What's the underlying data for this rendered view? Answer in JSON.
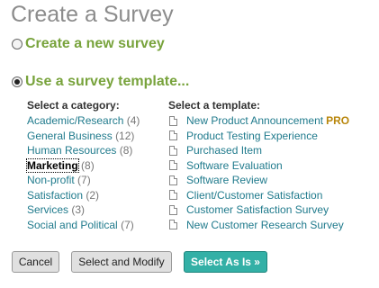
{
  "page": {
    "title": "Create a Survey"
  },
  "options": {
    "new_label": "Create a new survey",
    "template_label": "Use a survey template..."
  },
  "categories": {
    "header": "Select a category:",
    "items": [
      {
        "name": "Academic/Research",
        "count": "(4)"
      },
      {
        "name": "General Business",
        "count": "(12)"
      },
      {
        "name": "Human Resources",
        "count": "(8)"
      },
      {
        "name": "Marketing",
        "count": "(8)"
      },
      {
        "name": "Non-profit",
        "count": "(7)"
      },
      {
        "name": "Satisfaction",
        "count": "(2)"
      },
      {
        "name": "Services",
        "count": "(3)"
      },
      {
        "name": "Social and Political",
        "count": "(7)"
      }
    ]
  },
  "templates": {
    "header": "Select a template:",
    "items": [
      {
        "name": "New Product Announcement",
        "badge": "PRO"
      },
      {
        "name": "Product Testing Experience"
      },
      {
        "name": "Purchased Item"
      },
      {
        "name": "Software Evaluation"
      },
      {
        "name": "Software Review"
      },
      {
        "name": "Client/Customer Satisfaction"
      },
      {
        "name": "Customer Satisfaction Survey"
      },
      {
        "name": "New Customer Research Survey"
      }
    ]
  },
  "buttons": {
    "cancel": "Cancel",
    "select_modify": "Select and Modify",
    "select_as_is": "Select As Is »"
  },
  "colors": {
    "accent_green": "#78a33c",
    "link_teal": "#1f7a8c",
    "primary_button": "#33b0a6",
    "pro_badge": "#b8860b"
  },
  "icons": {
    "template_icon": "document-icon"
  }
}
